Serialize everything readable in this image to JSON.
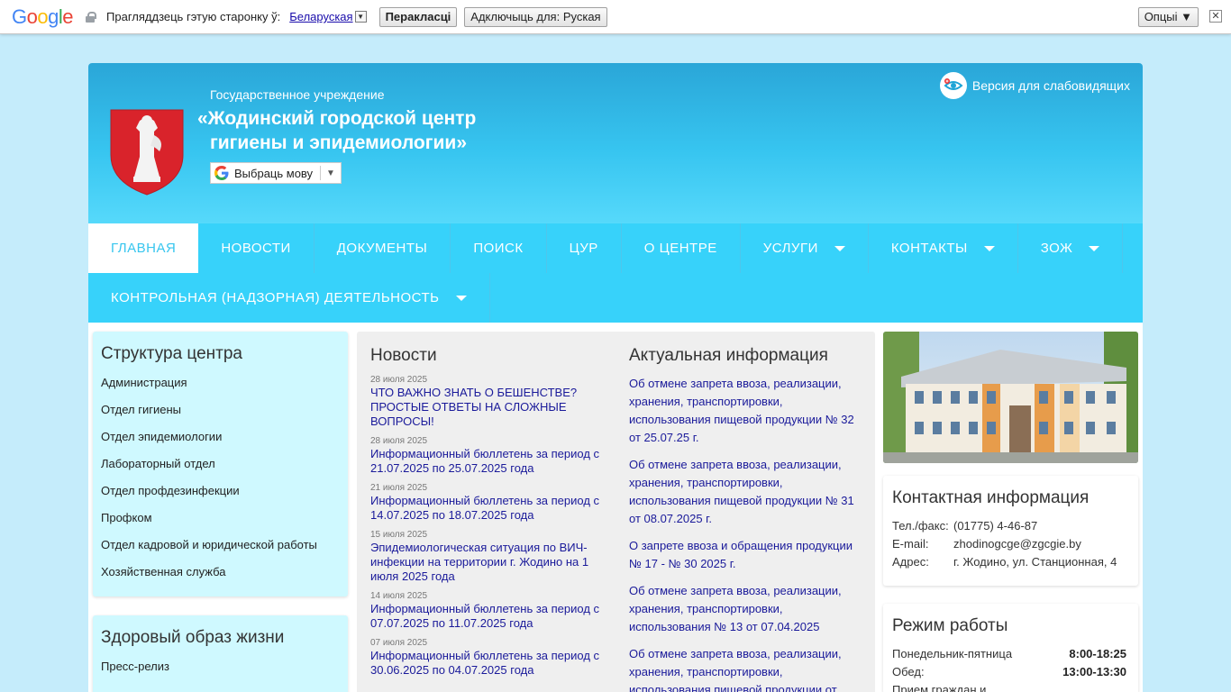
{
  "translate_bar": {
    "prompt": "Прагляддзець гэтую старонку ў:",
    "language": "Беларуская",
    "translate_btn": "Перакласці",
    "disable_btn": "Адключыць для: Руская",
    "options_btn": "Опцыі ▼",
    "close": "✕"
  },
  "header": {
    "subtitle": "Государственное учреждение",
    "title_line1": "«Жодинский городской центр",
    "title_line2": "гигиены и эпидемиологии»",
    "lang_select": "Выбраць мову",
    "vision_link": "Версия для слабовидящих"
  },
  "nav": {
    "row1": [
      {
        "label": "ГЛАВНАЯ",
        "active": true,
        "caret": false
      },
      {
        "label": "НОВОСТИ",
        "caret": false
      },
      {
        "label": "ДОКУМЕНТЫ",
        "caret": false
      },
      {
        "label": "ПОИСК",
        "caret": false
      },
      {
        "label": "ЦУР",
        "caret": false
      },
      {
        "label": "О ЦЕНТРЕ",
        "caret": false
      },
      {
        "label": "УСЛУГИ",
        "caret": true
      },
      {
        "label": "КОНТАКТЫ",
        "caret": true
      },
      {
        "label": "ЗОЖ",
        "caret": true
      }
    ],
    "row2": [
      {
        "label": "КОНТРОЛЬНАЯ (НАДЗОРНАЯ) ДЕЯТЕЛЬНОСТЬ",
        "caret": true
      }
    ]
  },
  "structure": {
    "title": "Структура центра",
    "links": [
      "Администрация",
      "Отдел гигиены",
      "Отдел эпидемиологии",
      "Лабораторный отдел",
      "Отдел профдезинфекции",
      "Профком",
      "Отдел кадровой и юридической работы",
      "Хозяйственная служба"
    ]
  },
  "healthy": {
    "title": "Здоровый образ жизни",
    "links": [
      "Пресс-релиз"
    ]
  },
  "news": {
    "title": "Новости",
    "items": [
      {
        "date": "28 июля 2025",
        "text": "ЧТО ВАЖНО ЗНАТЬ О БЕШЕНСТВЕ? ПРОСТЫЕ ОТВЕТЫ НА СЛОЖНЫЕ ВОПРОСЫ!"
      },
      {
        "date": "28 июля 2025",
        "text": "Информационный бюллетень за период с 21.07.2025 по 25.07.2025 года"
      },
      {
        "date": "21 июля 2025",
        "text": "Информационный бюллетень за период с 14.07.2025 по 18.07.2025 года"
      },
      {
        "date": "15 июля 2025",
        "text": "Эпидемиологическая ситуация по ВИЧ-инфекции на территории г. Жодино на 1 июля 2025 года"
      },
      {
        "date": "14 июля 2025",
        "text": "Информационный бюллетень за период с 07.07.2025 по 11.07.2025 года"
      },
      {
        "date": "07 июля 2025",
        "text": "Информационный бюллетень за период с 30.06.2025 по 04.07.2025 года"
      }
    ]
  },
  "actual": {
    "title": "Актуальная информация",
    "items": [
      "Об отмене запрета ввоза, реализации, хранения, транспортировки, использования пищевой продукции № 32 от 25.07.25 г.",
      "Об отмене запрета ввоза, реализации, хранения, транспортировки, использования пищевой продукции № 31 от 08.07.2025 г.",
      "О запрете ввоза и обращения продукции № 17 - № 30 2025 г.",
      "Об отмене запрета ввоза, реализации, хранения, транспортировки, использования № 13 от 07.04.2025",
      "Об отмене запрета ввоза, реализации, хранения, транспортировки, использования пищевой продукции от"
    ]
  },
  "contact": {
    "title": "Контактная информация",
    "rows": [
      {
        "label": "Тел./факс:",
        "value": "(01775) 4-46-87"
      },
      {
        "label": "E-mail:",
        "value": "zhodinogcge@zgcgie.by"
      },
      {
        "label": "Адрес:",
        "value": "г. Жодино, ул. Станционная, 4"
      }
    ]
  },
  "hours": {
    "title": "Режим работы",
    "rows": [
      {
        "label": "Понедельник-пятница",
        "value": "8:00-18:25"
      },
      {
        "label": "Обед:",
        "value": "13:00-13:30"
      },
      {
        "label": "Прием граждан и",
        "value": ""
      }
    ]
  },
  "colors": {
    "header_top": "#2aa6d8",
    "nav": "#37d2fa",
    "page_bg": "#c5ecfb",
    "side_box": "#cff9ff"
  }
}
